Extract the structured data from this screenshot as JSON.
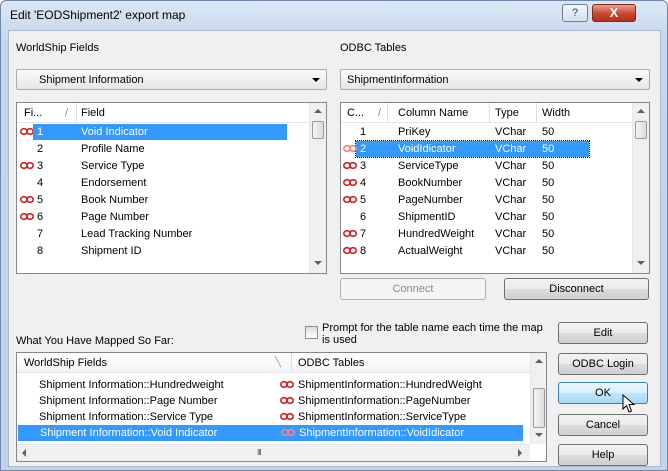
{
  "window": {
    "title": "Edit 'EODShipment2' export map",
    "help_label": "?",
    "close_label": "X"
  },
  "left": {
    "label": "WorldShip Fields",
    "combo_value": "Shipment Information",
    "col_num_header": "Fi...",
    "col_sort": "/",
    "col_field_header": "Field",
    "rows": [
      {
        "num": "1",
        "field": "Void Indicator",
        "linked": true,
        "selected": true
      },
      {
        "num": "2",
        "field": "Profile Name",
        "linked": false,
        "selected": false
      },
      {
        "num": "3",
        "field": "Service Type",
        "linked": true,
        "selected": false
      },
      {
        "num": "4",
        "field": "Endorsement",
        "linked": false,
        "selected": false
      },
      {
        "num": "5",
        "field": "Book Number",
        "linked": true,
        "selected": false
      },
      {
        "num": "6",
        "field": "Page Number",
        "linked": true,
        "selected": false
      },
      {
        "num": "7",
        "field": "Lead Tracking Number",
        "linked": false,
        "selected": false
      },
      {
        "num": "8",
        "field": "Shipment ID",
        "linked": false,
        "selected": false
      }
    ]
  },
  "right": {
    "label": "ODBC Tables",
    "combo_value": "ShipmentInformation",
    "col_num_header": "C...",
    "col_sort": "/",
    "col_name_header": "Column Name",
    "col_type_header": "Type",
    "col_width_header": "Width",
    "rows": [
      {
        "num": "1",
        "name": "PriKey",
        "type": "VChar",
        "width": "50",
        "linked": false,
        "selected": false
      },
      {
        "num": "2",
        "name": "VoidIdicator",
        "type": "VChar",
        "width": "50",
        "linked": true,
        "selected": true
      },
      {
        "num": "3",
        "name": "ServiceType",
        "type": "VChar",
        "width": "50",
        "linked": true,
        "selected": false
      },
      {
        "num": "4",
        "name": "BookNumber",
        "type": "VChar",
        "width": "50",
        "linked": true,
        "selected": false
      },
      {
        "num": "5",
        "name": "PageNumber",
        "type": "VChar",
        "width": "50",
        "linked": true,
        "selected": false
      },
      {
        "num": "6",
        "name": "ShipmentID",
        "type": "VChar",
        "width": "50",
        "linked": false,
        "selected": false
      },
      {
        "num": "7",
        "name": "HundredWeight",
        "type": "VChar",
        "width": "50",
        "linked": true,
        "selected": false
      },
      {
        "num": "8",
        "name": "ActualWeight",
        "type": "VChar",
        "width": "50",
        "linked": true,
        "selected": false
      }
    ]
  },
  "buttons": {
    "connect": "Connect",
    "disconnect": "Disconnect",
    "edit": "Edit",
    "odbc_login": "ODBC Login",
    "ok": "OK",
    "cancel": "Cancel",
    "help": "Help"
  },
  "mapped": {
    "label": "What You Have Mapped So Far:",
    "prompt_checkbox": "Prompt for the table name each time the map is used",
    "col_ws": "WorldShip Fields",
    "col_odbc": "ODBC Tables",
    "scroll_dots": "III",
    "rows": [
      {
        "ws": "Shipment Information::Hundredweight",
        "odbc": "ShipmentInformation::HundredWeight",
        "selected": false
      },
      {
        "ws": "Shipment Information::Page Number",
        "odbc": "ShipmentInformation::PageNumber",
        "selected": false
      },
      {
        "ws": "Shipment Information::Service Type",
        "odbc": "ShipmentInformation::ServiceType",
        "selected": false
      },
      {
        "ws": "Shipment Information::Void Indicator",
        "odbc": "ShipmentInformation::VoidIdicator",
        "selected": true
      }
    ]
  },
  "colors": {
    "selection": "#3399ff",
    "link_icon": "#d12020",
    "link_icon_selected": "#ff8080"
  },
  "icons": {
    "link": "chain-link-icon",
    "cursor": "mouse-pointer-icon"
  }
}
